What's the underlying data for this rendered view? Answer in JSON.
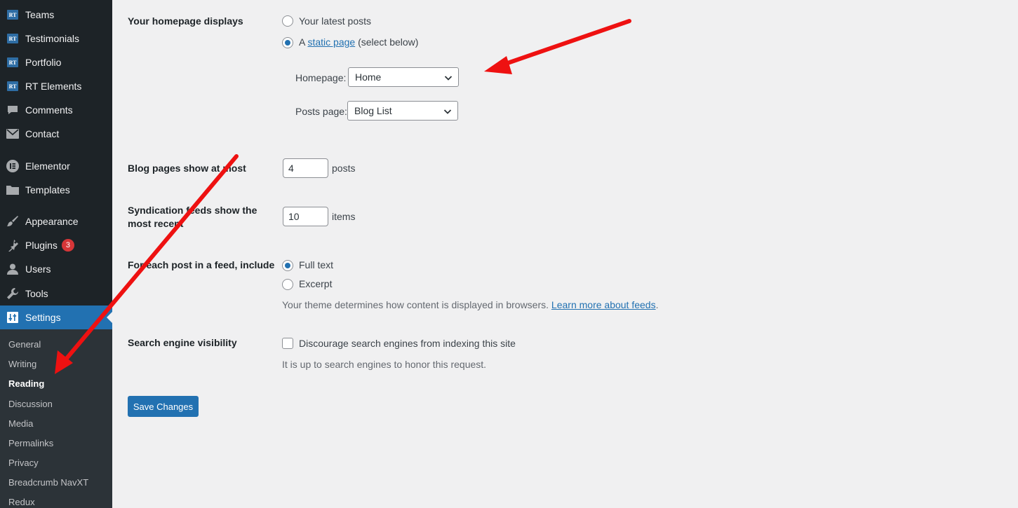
{
  "sidebar": {
    "items": [
      {
        "label": "Teams",
        "icon": "rt-icon"
      },
      {
        "label": "Testimonials",
        "icon": "rt-icon"
      },
      {
        "label": "Portfolio",
        "icon": "rt-icon"
      },
      {
        "label": "RT Elements",
        "icon": "rt-icon"
      },
      {
        "label": "Comments",
        "icon": "comment-icon"
      },
      {
        "label": "Contact",
        "icon": "envelope-icon"
      },
      {
        "label": "Elementor",
        "icon": "elementor-icon"
      },
      {
        "label": "Templates",
        "icon": "folder-icon"
      },
      {
        "label": "Appearance",
        "icon": "brush-icon"
      },
      {
        "label": "Plugins",
        "icon": "plugin-icon",
        "badge": "3"
      },
      {
        "label": "Users",
        "icon": "user-icon"
      },
      {
        "label": "Tools",
        "icon": "wrench-icon"
      },
      {
        "label": "Settings",
        "icon": "settings-icon"
      }
    ],
    "rt_badge_text": "RT",
    "submenu": [
      "General",
      "Writing",
      "Reading",
      "Discussion",
      "Media",
      "Permalinks",
      "Privacy",
      "Breadcrumb NavXT",
      "Redux"
    ],
    "current_submenu": "Reading"
  },
  "form": {
    "homepage_displays": {
      "label": "Your homepage displays",
      "option_latest": "Your latest posts",
      "option_static_prefix": "A",
      "option_static_link": "static page",
      "option_static_suffix": "(select below)",
      "homepage_label": "Homepage:",
      "homepage_value": "Home",
      "posts_page_label": "Posts page:",
      "posts_page_value": "Blog List"
    },
    "blog_pages": {
      "label": "Blog pages show at most",
      "value": "4",
      "unit": "posts"
    },
    "syndication": {
      "label": "Syndication feeds show the most recent",
      "value": "10",
      "unit": "items"
    },
    "feed_include": {
      "label": "For each post in a feed, include",
      "option_full": "Full text",
      "option_excerpt": "Excerpt",
      "desc_prefix": "Your theme determines how content is displayed in browsers.",
      "desc_link": "Learn more about feeds",
      "desc_suffix": "."
    },
    "search_visibility": {
      "label": "Search engine visibility",
      "checkbox_label": "Discourage search engines from indexing this site",
      "desc": "It is up to search engines to honor this request."
    },
    "save_label": "Save Changes"
  },
  "colors": {
    "accent": "#2271b1",
    "sidebar_bg": "#1d2327",
    "arrow": "#ee1111",
    "badge": "#d63638"
  }
}
